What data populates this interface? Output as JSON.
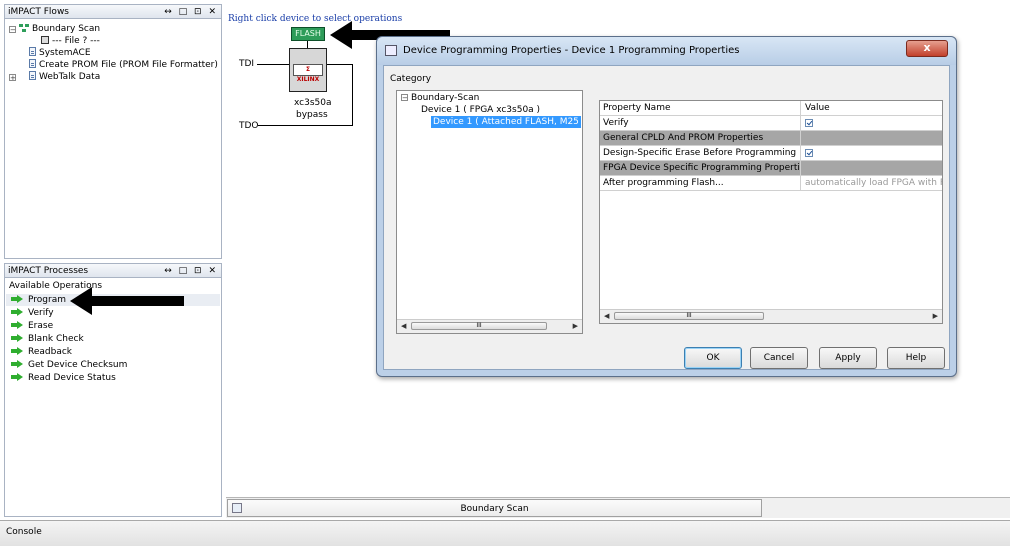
{
  "flows_panel": {
    "title": "iMPACT Flows",
    "controls": "↔ □ ⊡ ✕",
    "items": [
      {
        "label": "Boundary Scan"
      },
      {
        "label": "--- File ? ---"
      },
      {
        "label": "SystemACE"
      },
      {
        "label": "Create PROM File (PROM File Formatter)"
      },
      {
        "label": "WebTalk Data"
      }
    ]
  },
  "processes_panel": {
    "title": "iMPACT Processes",
    "controls": "↔ □ ⊡ ✕",
    "heading": "Available Operations",
    "operations": [
      {
        "label": "Program"
      },
      {
        "label": "Verify"
      },
      {
        "label": "Erase"
      },
      {
        "label": "Blank Check"
      },
      {
        "label": "Readback"
      },
      {
        "label": "Get Device Checksum"
      },
      {
        "label": "Read Device Status"
      }
    ]
  },
  "canvas": {
    "hint": "Right click device to select operations",
    "flash_label": "FLASH",
    "chip_logo": "Σ XILINX",
    "tdi": "TDI",
    "tdo": "TDO",
    "device_name": "xc3s50a",
    "device_mode": "bypass"
  },
  "tab": {
    "label": "Boundary Scan"
  },
  "console": {
    "label": "Console"
  },
  "dialog": {
    "title": "Device Programming Properties - Device 1 Programming Properties",
    "close_label": "x",
    "category_label": "Category",
    "tree": [
      {
        "label": "Boundary-Scan"
      },
      {
        "label": "Device 1 ( FPGA xc3s50a )"
      },
      {
        "label": "Device 1 ( Attached FLASH, M25"
      }
    ],
    "scroll_thumb": "III",
    "grid": {
      "col_name": "Property Name",
      "col_value": "Value",
      "rows": [
        {
          "name": "Verify",
          "value": "",
          "checked": true
        },
        {
          "name": "General CPLD And PROM Properties",
          "category": true
        },
        {
          "name": "Design-Specific Erase Before Programming",
          "value": "",
          "checked": true
        },
        {
          "name": "FPGA Device Specific Programming Properties",
          "category": true
        },
        {
          "name": "After programming Flash...",
          "value": "automatically load FPGA with Fl"
        }
      ]
    },
    "buttons": {
      "ok": "OK",
      "cancel": "Cancel",
      "apply": "Apply",
      "help": "Help"
    }
  }
}
